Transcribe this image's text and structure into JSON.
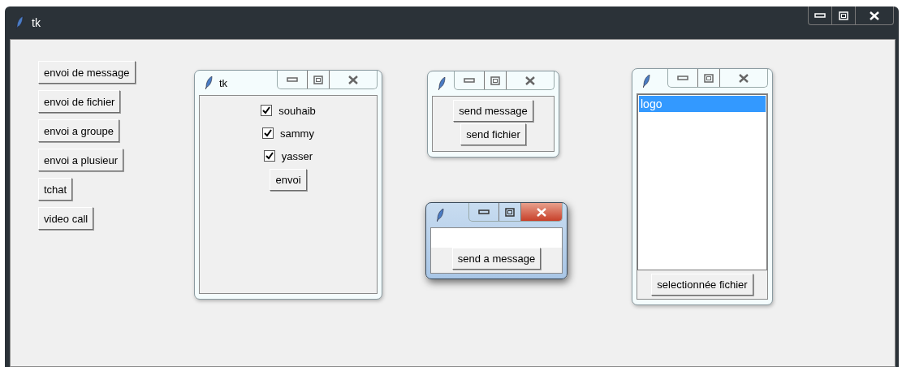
{
  "window": {
    "title": "tk"
  },
  "left_buttons": [
    "envoi de message",
    "envoi de fichier",
    "envoi a groupe",
    "envoi a plusieur",
    "tchat",
    "video call"
  ],
  "dialogs": [
    {
      "kind": "checklist",
      "title": "tk",
      "active": false,
      "items": [
        {
          "label": "souhaib",
          "checked": true
        },
        {
          "label": "sammy",
          "checked": true
        },
        {
          "label": "yasser",
          "checked": true
        }
      ],
      "button": "envoi"
    },
    {
      "kind": "buttons",
      "active": false,
      "buttons": [
        "send message",
        "send fichier"
      ]
    },
    {
      "kind": "entry",
      "active": true,
      "button": "send a message"
    },
    {
      "kind": "listbox",
      "active": false,
      "items": [
        {
          "label": "logo",
          "selected": true
        }
      ],
      "button": "selectionnée fichier"
    }
  ]
}
